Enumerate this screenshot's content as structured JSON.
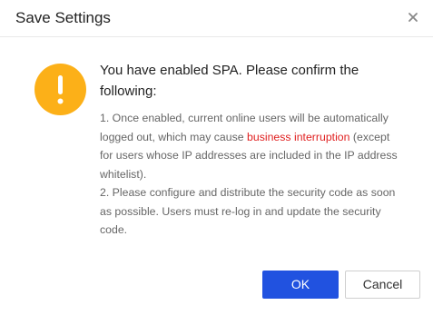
{
  "dialog": {
    "title": "Save Settings",
    "close_icon": "close-icon",
    "warning_icon": "exclamation-circle-icon",
    "warning_color": "#fcb018",
    "heading": "You have enabled SPA. Please confirm the following:",
    "item1_before": "1. Once enabled, current online users will be automatically logged out, which may cause ",
    "item1_highlight": "business interruption",
    "item1_after": " (except for users whose IP addresses are included in the IP address whitelist).",
    "item2": "2. Please configure and distribute the security code as soon as possible. Users must re-log in and update the security code.",
    "highlight_color": "#e02020",
    "ok_label": "OK",
    "cancel_label": "Cancel",
    "primary_color": "#2152e0"
  }
}
